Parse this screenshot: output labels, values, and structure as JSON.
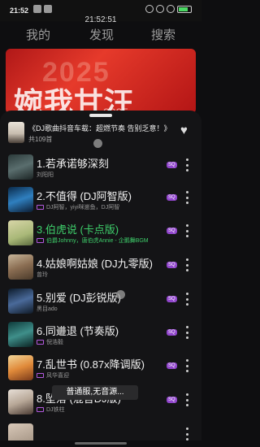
{
  "statusbar": {
    "time": "21:52",
    "center_time": "21:52:51",
    "battery_label": "电池"
  },
  "tabs": [
    {
      "label": "我的"
    },
    {
      "label": "发现"
    },
    {
      "label": "搜索"
    }
  ],
  "banner": {
    "text_top": "2025",
    "text_main": "婉我甘汪",
    "text_small": "2025"
  },
  "playlist": {
    "title": "《DJ歌曲抖音车载：超燃节奏 告别乏意！》",
    "count": "共109首"
  },
  "songs": [
    {
      "title": "1.若承诺够深刻",
      "artist": "刘阳阳",
      "tag": false,
      "active": false,
      "badge": "SQ"
    },
    {
      "title": "2.不值得 (DJ阿智版)",
      "artist": "DJ阿智，yiyi咪崽鱼，DJ阿智",
      "tag": true,
      "active": false,
      "badge": "SQ"
    },
    {
      "title": "3.伯虎说 (卡点版)",
      "artist": "伯爵Johnny，唐伯虎Annie - 企鹅舞BGM",
      "tag": true,
      "active": true,
      "badge": "SQ"
    },
    {
      "title": "4.姑娘啊姑娘 (DJ九零版)",
      "artist": "曾玲",
      "tag": false,
      "active": false,
      "badge": "SQ"
    },
    {
      "title": "5.别爱 (DJ彭锐版)",
      "artist": "黑目ado",
      "tag": false,
      "active": false,
      "badge": "SQ"
    },
    {
      "title": "6.同进退 (节奏版)",
      "artist": "倪浩毅",
      "tag": true,
      "active": false,
      "badge": "SQ"
    },
    {
      "title": "7.乱世书 (0.87x降调版)",
      "artist": "风华喜迎",
      "tag": true,
      "active": false,
      "badge": "SQ"
    },
    {
      "title": "8.坠落 (混音DJ版)",
      "artist": "DJ铁柱",
      "tag": true,
      "active": false,
      "badge": "SQ"
    }
  ],
  "toast": "普通服,无音源..."
}
